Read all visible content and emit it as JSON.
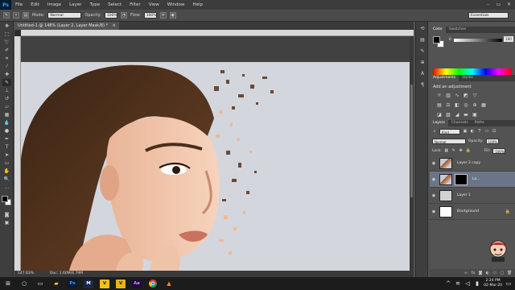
{
  "menubar": {
    "logo": "Ps",
    "items": [
      "File",
      "Edit",
      "Image",
      "Layer",
      "Type",
      "Select",
      "Filter",
      "View",
      "Window",
      "Help"
    ]
  },
  "options": {
    "mode_label": "Mode:",
    "mode_value": "Normal",
    "opacity_label": "Opacity:",
    "opacity_value": "100%",
    "flow_label": "Flow:",
    "flow_value": "100%",
    "workspace": "Essentials"
  },
  "document": {
    "tab_title": "Untitled-1 @ 148% (Layer 2, Layer Mask/8) *",
    "zoom": "147.83%",
    "doc_info": "Doc: 1.60M/4.79M"
  },
  "panels": {
    "color_tab": "Color",
    "swatches_tab": "Swatches",
    "k_label": "K",
    "k_value": "100",
    "adjustments_tab": "Adjustments",
    "styles_tab": "Styles",
    "add_adjustment": "Add an adjustment"
  },
  "layers_panel": {
    "tabs": [
      "Layers",
      "Channels",
      "Paths"
    ],
    "kind_label": "Kind",
    "blend_mode": "Normal",
    "opacity_label": "Opacity:",
    "opacity_value": "100%",
    "lock_label": "Lock:",
    "fill_label": "Fill:",
    "fill_value": "100%",
    "layers": [
      {
        "name": "Layer 2 copy",
        "thumb": "face",
        "mask": false,
        "selected": false
      },
      {
        "name": "La...",
        "thumb": "face",
        "mask": true,
        "selected": true
      },
      {
        "name": "Layer 1",
        "thumb": "grey",
        "mask": false,
        "selected": false
      },
      {
        "name": "Background",
        "thumb": "white",
        "mask": false,
        "selected": false
      }
    ]
  },
  "taskbar": {
    "time": "2:24 PM",
    "date": "02-Mar-20",
    "apps": [
      {
        "label": "Ps",
        "bg": "#001d34",
        "fg": "#31a8ff"
      },
      {
        "label": "M",
        "bg": "#15294a",
        "fg": "#ffffff"
      },
      {
        "label": "V",
        "bg": "#f2c21b",
        "fg": "#222222"
      },
      {
        "label": "V",
        "bg": "#e8b518",
        "fg": "#222222"
      },
      {
        "label": "Ae",
        "bg": "#1f0b3b",
        "fg": "#d291ff"
      }
    ]
  },
  "colors": {
    "accent_selected_layer": "#6a7587",
    "canvas_bg": "#d3d6dc"
  }
}
